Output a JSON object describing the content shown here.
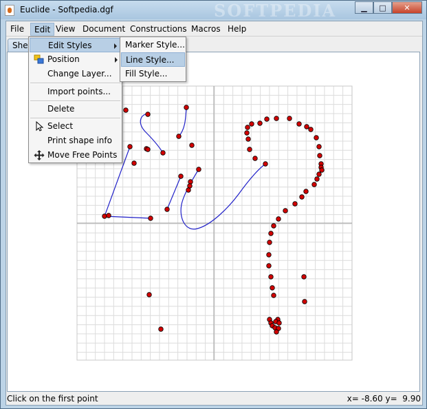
{
  "window": {
    "title": "Euclide - Softpedia.dgf",
    "watermark": "SOFTPEDIA",
    "minimize_glyph": "▁",
    "maximize_glyph": "□",
    "close_glyph": "✕"
  },
  "menubar": {
    "items": [
      {
        "label": "File"
      },
      {
        "label": "Edit"
      },
      {
        "label": "View"
      },
      {
        "label": "Document"
      },
      {
        "label": "Constructions"
      },
      {
        "label": "Macros"
      },
      {
        "label": "Help"
      }
    ]
  },
  "tab": {
    "label": "Sheet"
  },
  "edit_menu": {
    "items": [
      {
        "label": "Edit Styles",
        "has_submenu": true
      },
      {
        "label": "Position",
        "has_submenu": true,
        "icon": "position-icon"
      },
      {
        "label": "Change Layer..."
      },
      {
        "label": "Import points..."
      },
      {
        "label": "Delete"
      },
      {
        "label": "Select",
        "icon": "cursor-arrow-icon"
      },
      {
        "label": "Print shape info"
      },
      {
        "label": "Move Free Points",
        "icon": "move-icon"
      }
    ]
  },
  "styles_submenu": {
    "items": [
      {
        "label": "Marker Style..."
      },
      {
        "label": "Line Style..."
      },
      {
        "label": "Fill Style..."
      }
    ]
  },
  "status": {
    "message": "Click on the first point",
    "coords": "x= -8.60 y=  9.90"
  },
  "colors": {
    "point_fill": "#d20000",
    "curve": "#2020c8",
    "grid": "#dcdcdc",
    "axis": "#a0a0a0",
    "menu_highlight": "#b8cfe5"
  },
  "points": [
    [
      181,
      158
    ],
    [
      213,
      164
    ],
    [
      269,
      154
    ],
    [
      258,
      196
    ],
    [
      277,
      209
    ],
    [
      187,
      211
    ],
    [
      211,
      214
    ],
    [
      213,
      215
    ],
    [
      235,
      220
    ],
    [
      193,
      235
    ],
    [
      287,
      244
    ],
    [
      261,
      254
    ],
    [
      275,
      262
    ],
    [
      274,
      268
    ],
    [
      272,
      274
    ],
    [
      241,
      302
    ],
    [
      150,
      312
    ],
    [
      156,
      311
    ],
    [
      217,
      315
    ],
    [
      364,
      178
    ],
    [
      376,
      177
    ],
    [
      358,
      183
    ],
    [
      386,
      171
    ],
    [
      400,
      170
    ],
    [
      419,
      170
    ],
    [
      433,
      178
    ],
    [
      444,
      182
    ],
    [
      450,
      186
    ],
    [
      357,
      191
    ],
    [
      359,
      200
    ],
    [
      458,
      198
    ],
    [
      361,
      215
    ],
    [
      462,
      211
    ],
    [
      369,
      228
    ],
    [
      463,
      224
    ],
    [
      384,
      236
    ],
    [
      465,
      236
    ],
    [
      465,
      241
    ],
    [
      466,
      245
    ],
    [
      462,
      251
    ],
    [
      459,
      258
    ],
    [
      455,
      266
    ],
    [
      443,
      276
    ],
    [
      437,
      284
    ],
    [
      427,
      294
    ],
    [
      413,
      304
    ],
    [
      403,
      316
    ],
    [
      396,
      326
    ],
    [
      392,
      337
    ],
    [
      390,
      350
    ],
    [
      389,
      368
    ],
    [
      389,
      384
    ],
    [
      392,
      400
    ],
    [
      440,
      400
    ],
    [
      394,
      416
    ],
    [
      396,
      427
    ],
    [
      441,
      436
    ],
    [
      390,
      462
    ],
    [
      402,
      462
    ],
    [
      392,
      467
    ],
    [
      399,
      465
    ],
    [
      394,
      471
    ],
    [
      404,
      467
    ],
    [
      398,
      474
    ],
    [
      403,
      475
    ],
    [
      400,
      480
    ],
    [
      215,
      426
    ],
    [
      232,
      476
    ]
  ],
  "curves": [
    "M213,164 C205,162 195,175 210,190 C220,200 230,212 235,220",
    "M269,154 C268,168 268,185 258,196",
    "M187,211 L150,312 L217,315",
    "M261,254 L241,302",
    "M287,244 C280,255 265,280 262,295 C258,315 268,335 285,330 C305,325 330,300 345,280 C358,262 372,245 384,236"
  ]
}
